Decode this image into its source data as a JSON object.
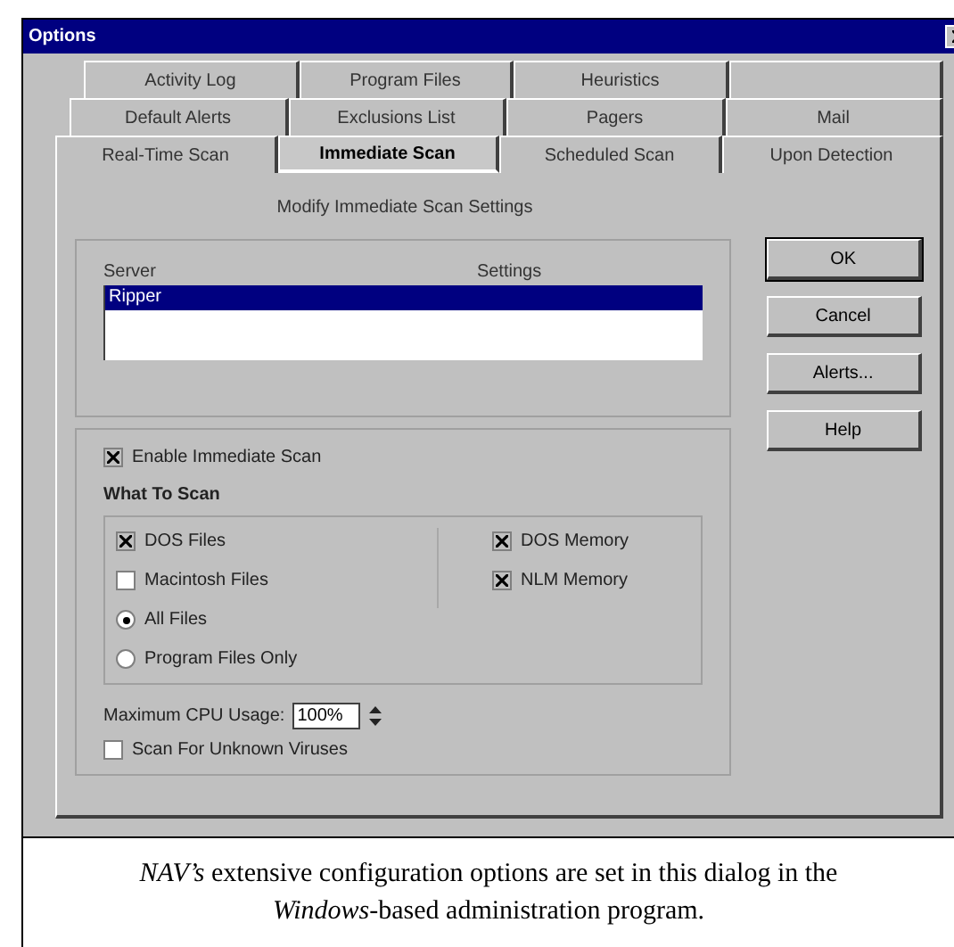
{
  "window": {
    "title": "Options"
  },
  "tab_rows": [
    [
      {
        "label": "Activity Log",
        "selected": false
      },
      {
        "label": "Program Files",
        "selected": false
      },
      {
        "label": "Heuristics",
        "selected": false
      }
    ],
    [
      {
        "label": "Default Alerts",
        "selected": false
      },
      {
        "label": "Exclusions List",
        "selected": false
      },
      {
        "label": "Pagers",
        "selected": false
      },
      {
        "label": "Mail",
        "selected": false
      }
    ],
    [
      {
        "label": "Real-Time Scan",
        "selected": false
      },
      {
        "label": "Immediate Scan",
        "selected": true
      },
      {
        "label": "Scheduled Scan",
        "selected": false
      },
      {
        "label": "Upon Detection",
        "selected": false
      }
    ]
  ],
  "heading": "Modify Immediate Scan Settings",
  "server_list": {
    "columns": [
      "Server",
      "Settings"
    ],
    "rows": [
      {
        "server": "Ripper",
        "selected": true
      }
    ]
  },
  "buttons": [
    "OK",
    "Cancel",
    "Alerts...",
    "Help"
  ],
  "enable_scan": {
    "label": "Enable Immediate Scan",
    "checked": true
  },
  "what_to_scan": {
    "title": "What To Scan",
    "left": [
      {
        "kind": "checkbox",
        "label": "DOS Files",
        "checked": true
      },
      {
        "kind": "checkbox",
        "label": "Macintosh Files",
        "checked": false
      },
      {
        "kind": "radio",
        "label": "All Files",
        "checked": true
      },
      {
        "kind": "radio",
        "label": "Program Files Only",
        "checked": false
      }
    ],
    "right": [
      {
        "label": "DOS Memory",
        "checked": true
      },
      {
        "label": "NLM Memory",
        "checked": true
      }
    ]
  },
  "cpu_usage": {
    "label": "Maximum CPU Usage:",
    "value": "100%"
  },
  "unknown_viruses": {
    "label": "Scan For Unknown Viruses",
    "checked": false
  },
  "caption": "*NAV’s* extensive configuration options are set in this dialog in the *Windows*-based administration program."
}
